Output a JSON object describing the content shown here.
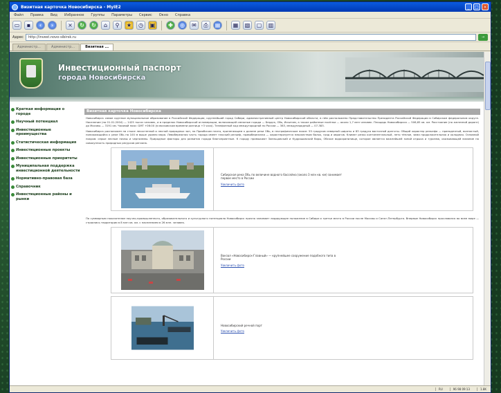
{
  "window": {
    "title": "Визитная карточка Новосибирска - MyIE2",
    "controls": [
      "_",
      "□",
      "×"
    ]
  },
  "menu": [
    "Файл",
    "Правка",
    "Вид",
    "Избранное",
    "Группы",
    "Параметры",
    "Сервис",
    "Окно",
    "Справка"
  ],
  "address": {
    "label": "Адрес",
    "url": "http://invest.novo-sibirsk.ru",
    "go_label": "→"
  },
  "tabs": [
    {
      "label": "Администр..."
    },
    {
      "label": "Администр..."
    },
    {
      "label": "Визитная ..."
    }
  ],
  "banner": {
    "title": "Инвестиционный паспорт",
    "subtitle": "города Новосибирска"
  },
  "sidebar": [
    {
      "label": "Краткая информация о городе"
    },
    {
      "label": "Научный потенциал"
    },
    {
      "label": "Инвестиционные преимущества"
    },
    {
      "label": "Статистическая информация"
    },
    {
      "label": "Инвестиционные проекты"
    },
    {
      "label": "Инвестиционные приоритеты"
    },
    {
      "label": "Муниципальная поддержка инвестиционной деятельности"
    },
    {
      "label": "Нормативно-правовая база"
    },
    {
      "label": "Справочник"
    },
    {
      "label": "Инвестиционные районы и рынки"
    }
  ],
  "content": {
    "heading": "Визитная карточка Новосибирска",
    "para1": "Новосибирск самое крупное муниципальное образование в Российской Федерации, крупнейший город Сибири, административный центр Новосибирской области, в нём расположено Представительство Президента Российской Федерации в Сибирском федеральном округе. Население (на 01.01.2004) — 1425 тысяч человек, и в пределах Новосибирской агломерации, включающей смежные города — Бердск, Обь, Искитим, а также районные посёлки — около 1,7 млн человек. Площадь Новосибирска — 506,65 кв. км. Расстояние (по железной дороге) до Москвы — 3191 км. Часовой пояс: GMT +06:00 (в московском времени разница +3 часа). Телефонный код междугородной по России — 383, международный — 07-383.",
    "para2": "Новосибирск расположен на стыке лесостепной и лесной природных зон, на Приобском плато, прилегающем к долине реки Обь, в географическом поясе: 55 градусов северной широты и 83 градуса восточной долготы. Общий характер рельефа — приподнятый, волнистый, понижающийся к реке Обь на 100 м выше уровня моря. Левобережная часть города имеет плоский рельеф, правобережная — характеризуется множеством балок, гряд и оврагов. Климат резко континентальный, лето тёплое, зима продолжительная и холодная. Основной покров: серые лесные почвы и черноземы. Природные факторы для развития города благоприятные. К городу примыкают Заельцовский и Кудряшовский боры, Обское водохранилище, которое является важнейшей зоной отдыха и туризма, оказывающей влияние на совокупность природных ресурсов региона.",
    "para3": "По суммарным показателям научно-промышленного, образовательного и культурного потенциала Новосибирск прочно занимает лидирующее положение в Сибири и третье место в России после Москвы и Санкт-Петербурга. Впервые Новосибирск прославился во всем мире — строились территории в 8 млн кв. км. с населением в 26 млн. человек.",
    "cards": [
      {
        "text": "Сибирская река Обь по величине водного бассейна (около 3 млн кв. км) занимает первое место в России",
        "link": "Увеличить фото"
      },
      {
        "text": "Вокзал «Новосибирск-Главный» — крупнейшее сооружение подобного типа в России",
        "link": "Увеличить фото"
      },
      {
        "text": "Новосибирский речной порт",
        "link": "Увеличить фото"
      }
    ]
  },
  "status": {
    "left": "",
    "items": [
      "RU",
      "96 98 09:13",
      "1.8K"
    ]
  }
}
